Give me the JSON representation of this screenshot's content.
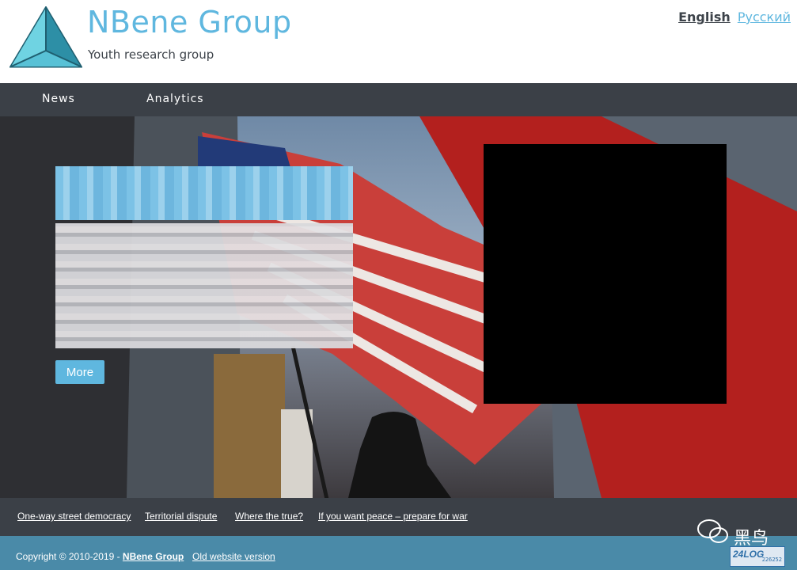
{
  "header": {
    "brand_title": "NBene Group",
    "brand_subtitle": "Youth research group",
    "languages": [
      "English",
      "Русский"
    ]
  },
  "nav": {
    "items": [
      "News",
      "Analytics"
    ]
  },
  "hero": {
    "more_label": "More"
  },
  "links_bar": {
    "links": [
      "One-way street democracy",
      "Territorial dispute",
      "Where the true?",
      "If you want peace – prepare for war"
    ]
  },
  "footer": {
    "copyright_prefix": "Copyright © 2010-2019 - ",
    "company": "NBene Group",
    "old_version": "Old website version",
    "counter_brand": "24LOG",
    "counter_number": "226252"
  },
  "watermark": {
    "text": "黑鸟"
  },
  "colors": {
    "accent": "#5fb7df",
    "nav_bg": "#3b4047",
    "footer_bg": "#4a8aa8"
  }
}
